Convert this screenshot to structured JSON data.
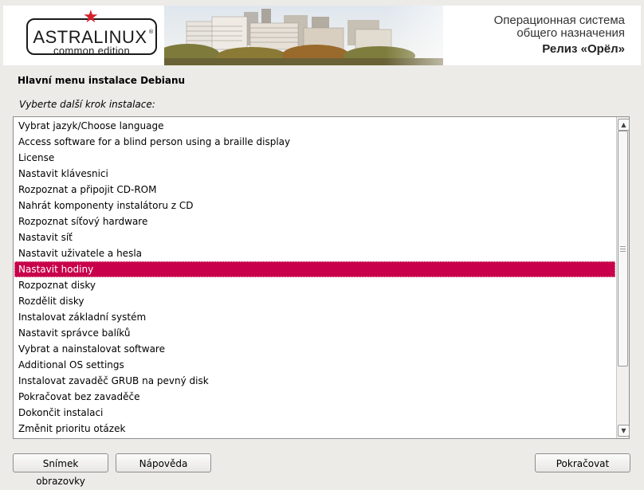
{
  "banner": {
    "logo_text": "ASTRALINUX",
    "logo_reg": "®",
    "logo_sub": "common edition",
    "os_title_line1": "Операционная система",
    "os_title_line2": "общего назначения",
    "release": "Релиз «Орёл»"
  },
  "page": {
    "heading": "Hlavní menu instalace Debianu",
    "prompt": "Vyberte další krok instalace:"
  },
  "menu": {
    "selected_index": 9,
    "items": [
      "Vybrat jazyk/Choose language",
      "Access software for a blind person using a braille display",
      "License",
      "Nastavit klávesnici",
      "Rozpoznat a připojit CD-ROM",
      "Nahrát komponenty instalátoru z CD",
      "Rozpoznat síťový hardware",
      "Nastavit síť",
      "Nastavit uživatele a hesla",
      "Nastavit hodiny",
      "Rozpoznat disky",
      "Rozdělit disky",
      "Instalovat základní systém",
      "Nastavit správce balíků",
      "Vybrat a nainstalovat software",
      "Additional OS settings",
      "Instalovat zavaděč GRUB na pevný disk",
      "Pokračovat bez zavaděče",
      "Dokončit instalaci",
      "Změnit prioritu otázek"
    ]
  },
  "buttons": {
    "screenshot": "Snímek obrazovky",
    "help": "Nápověda",
    "continue": "Pokračovat"
  },
  "colors": {
    "selection": "#c8004b",
    "logo_star": "#d4202a"
  },
  "icons": {
    "scroll_up": "chevron-up-icon",
    "scroll_down": "chevron-down-icon",
    "logo_star": "star-icon"
  }
}
